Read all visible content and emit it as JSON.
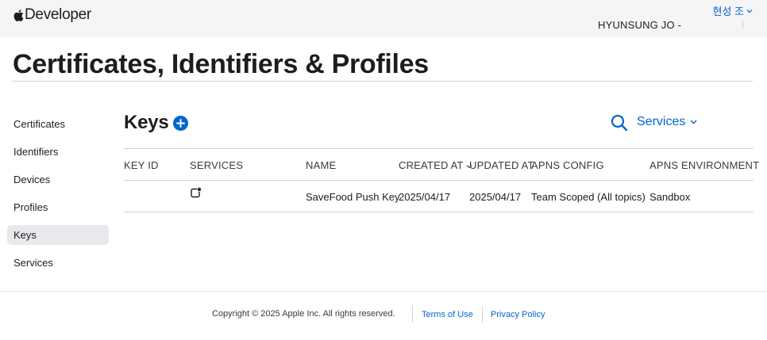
{
  "header": {
    "brand": "Developer",
    "account_name": "현성 조",
    "team_name": "HYUNSUNG JO -"
  },
  "page": {
    "title": "Certificates, Identifiers & Profiles"
  },
  "sidebar": {
    "active": "Keys",
    "items": [
      {
        "label": "Certificates"
      },
      {
        "label": "Identifiers"
      },
      {
        "label": "Devices"
      },
      {
        "label": "Profiles"
      },
      {
        "label": "Keys"
      },
      {
        "label": "Services"
      }
    ]
  },
  "section": {
    "title": "Keys",
    "add_icon": "plus-circle-icon",
    "search_icon": "search-icon",
    "filter_label": "Services"
  },
  "table": {
    "columns": [
      "KEY ID",
      "SERVICES",
      "NAME",
      "CREATED AT",
      "UPDATED AT",
      "APNS CONFIG",
      "APNS ENVIRONMENT"
    ],
    "sorted_column": "CREATED AT",
    "rows": [
      {
        "key_id": "",
        "services_icon": "push-notification-icon",
        "name": "SaveFood Push Key",
        "created_at": "2025/04/17",
        "updated_at": "2025/04/17",
        "apns_config": "Team Scoped (All topics)",
        "apns_environment": "Sandbox"
      }
    ]
  },
  "footer": {
    "copyright": "Copyright © 2025 Apple Inc. All rights reserved.",
    "terms_label": "Terms of Use",
    "privacy_label": "Privacy Policy"
  },
  "colors": {
    "accent": "#0066cc",
    "topbar_bg": "#f5f5f7",
    "active_nav_bg": "#e8e8ed",
    "divider": "#d2d2d7"
  }
}
